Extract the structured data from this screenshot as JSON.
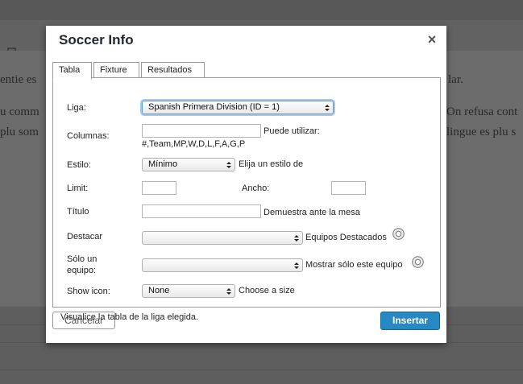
{
  "background": {
    "lines": [
      "entie es",
      "lar.",
      "u comm",
      "On refusa cont",
      "plu som",
      "lingue es plu s"
    ]
  },
  "modal": {
    "title": "Soccer Info",
    "close_label": "×",
    "tabs": [
      {
        "label": "Tabla",
        "active": true
      },
      {
        "label": "Fixture",
        "active": false
      },
      {
        "label": "Resultados",
        "active": false
      }
    ],
    "form": {
      "liga": {
        "label": "Liga:",
        "value": "Spanish Primera Division (ID = 1)"
      },
      "columnas": {
        "label": "Columnas:",
        "value": "",
        "hint": "Puede utilizar:",
        "hint2": "#,Team,MP,W,D,L,F,A,G,P"
      },
      "estilo": {
        "label": "Estilo:",
        "value": "Mínimo",
        "hint": "Elija un estilo de"
      },
      "limit": {
        "label": "Limit:",
        "value": ""
      },
      "ancho": {
        "label": "Ancho:",
        "value": ""
      },
      "titulo": {
        "label": "Título",
        "value": "",
        "hint": "Demuestra ante la mesa"
      },
      "destacar": {
        "label": "Destacar",
        "value": "",
        "hint": "Equipos Destacados"
      },
      "solo_equipo": {
        "label": "Sólo un",
        "label2": "equipo:",
        "value": "",
        "hint": "Mostrar sólo este equipo"
      },
      "show_icon": {
        "label": "Show icon:",
        "value": "None",
        "hint": "Choose a size"
      }
    },
    "footer_note": "Visualice la tabla de la liga elegida.",
    "cancel_label": "Cancelar",
    "insert_label": "Insertar"
  },
  "colors": {
    "primary_button": "#2689c3",
    "focus_ring": "#5b9dd9"
  }
}
